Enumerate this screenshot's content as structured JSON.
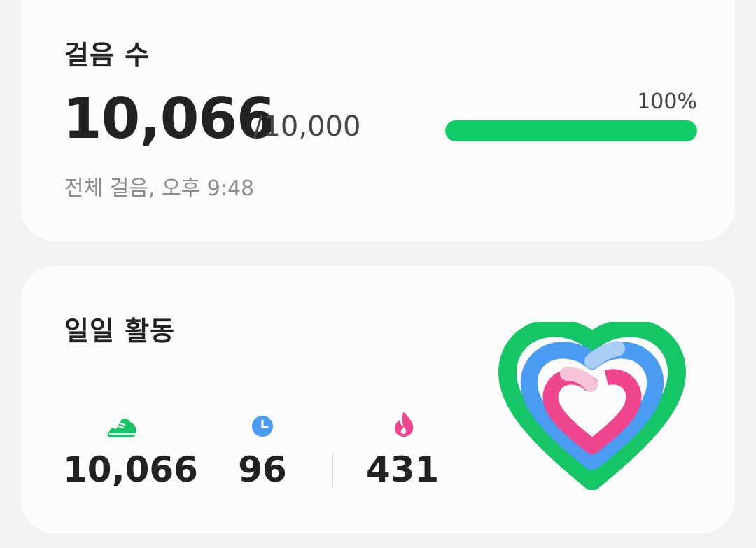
{
  "steps_card": {
    "title": "걸음 수",
    "count": "10,066",
    "goal": "/10,000",
    "subtext": "전체 걸음, 오후 9:48",
    "percent_label": "100%",
    "progress_fraction": 1.0
  },
  "activity_card": {
    "title": "일일 활동",
    "metrics": [
      {
        "icon": "shoe-icon",
        "value": "10,066",
        "color": "#16c566"
      },
      {
        "icon": "clock-icon",
        "value": "96",
        "color": "#4a9cf2"
      },
      {
        "icon": "flame-icon",
        "value": "431",
        "color": "#f0458f"
      }
    ]
  },
  "colors": {
    "green": "#16c566",
    "blue": "#4a9cf2",
    "pink": "#f0458f",
    "background": "#f2f2f2",
    "card": "#fcfcfc"
  }
}
